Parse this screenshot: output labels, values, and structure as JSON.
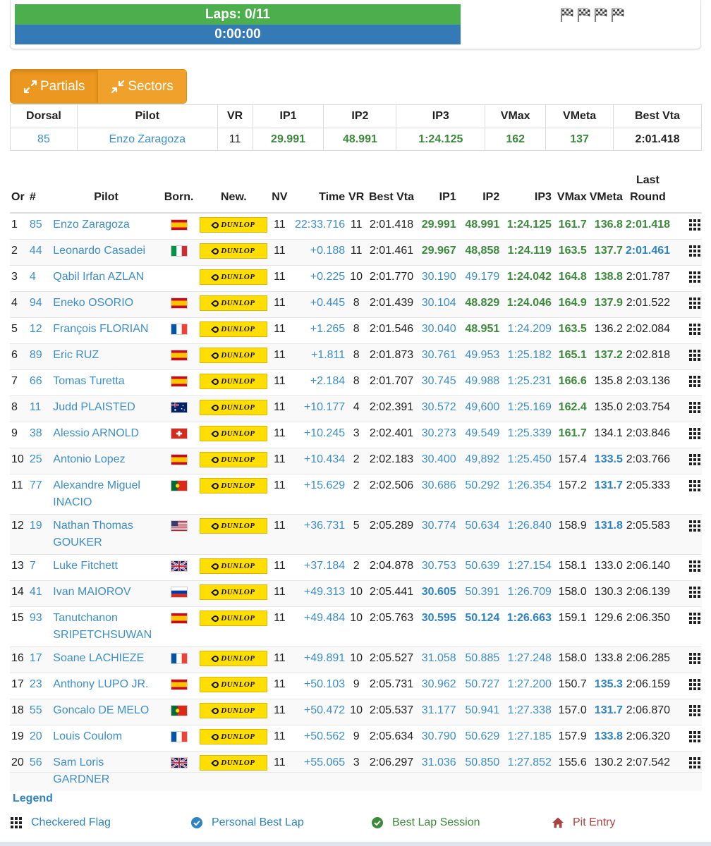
{
  "status": {
    "laps": "Laps: 0/11",
    "time": "0:00:00",
    "flag_icons": [
      "checkered-flag-icon",
      "checkered-flag-icon",
      "checkered-flag-icon",
      "checkered-flag-icon"
    ]
  },
  "tabs": [
    {
      "label": "Partials",
      "icon": "expand-arrows-icon"
    },
    {
      "label": "Sectors",
      "icon": "compress-arrows-icon"
    }
  ],
  "partials": {
    "headers": [
      "Dorsal",
      "Pilot",
      "VR",
      "IP1",
      "IP2",
      "IP3",
      "VMax",
      "VMeta",
      "Best Vta"
    ],
    "row": [
      "85",
      "Enzo Zaragoza",
      "11",
      "29.991",
      "48.991",
      "1:24.125",
      "162",
      "137",
      "2:01.418"
    ]
  },
  "classification": {
    "headers": {
      "or": "Or",
      "num": "#",
      "pilot": "Pilot",
      "born": "Born.",
      "new": "New.",
      "nv": "NV",
      "time": "Time",
      "vr": "VR",
      "best": "Best Vta",
      "ip1": "IP1",
      "ip2": "IP2",
      "ip3": "IP3",
      "vmax": "VMax",
      "vmeta": "VMeta",
      "last1": "Last",
      "last2": "Round"
    },
    "tyre_brand": "DUNLOP",
    "rows": [
      {
        "or": "1",
        "num": "85",
        "pilot": "Enzo Zaragoza",
        "flag": "es",
        "nv": "11",
        "time": "22:33.716",
        "vr": "11",
        "best": "2:01.418",
        "ip1": "29.991",
        "ip2": "48.991",
        "ip3": "1:24.125",
        "vmax": "161.7",
        "vmeta": "136.8",
        "last": "2:01.418",
        "hl": {
          "ip1": "g",
          "ip2": "g",
          "ip3": "g",
          "vmax": "g",
          "vmeta": "g",
          "last": "g"
        }
      },
      {
        "or": "2",
        "num": "44",
        "pilot": "Leonardo Casadei",
        "flag": "it",
        "nv": "11",
        "time": "+0.188",
        "vr": "11",
        "best": "2:01.461",
        "ip1": "29.967",
        "ip2": "48,858",
        "ip3": "1:24.119",
        "vmax": "163.5",
        "vmeta": "137.7",
        "last": "2:01.461",
        "hl": {
          "ip1": "g",
          "ip2": "g",
          "ip3": "g",
          "vmax": "g",
          "vmeta": "g",
          "last": "b"
        }
      },
      {
        "or": "3",
        "num": "4",
        "pilot": "Qabil Irfan AZLAN",
        "flag": "",
        "nv": "11",
        "time": "+0.225",
        "vr": "10",
        "best": "2:01.770",
        "ip1": "30.190",
        "ip2": "49.179",
        "ip3": "1:24.042",
        "vmax": "164.8",
        "vmeta": "138.8",
        "last": "2:01.787",
        "hl": {
          "ip1": "l",
          "ip2": "l",
          "ip3": "g",
          "vmax": "g",
          "vmeta": "g",
          "last": ""
        }
      },
      {
        "or": "4",
        "num": "94",
        "pilot": "Eneko OSORIO",
        "flag": "es",
        "nv": "11",
        "time": "+0.445",
        "vr": "8",
        "best": "2:01.439",
        "ip1": "30.104",
        "ip2": "48.829",
        "ip3": "1:24.046",
        "vmax": "164.9",
        "vmeta": "137.9",
        "last": "2:01.522",
        "hl": {
          "ip1": "l",
          "ip2": "g",
          "ip3": "g",
          "vmax": "g",
          "vmeta": "g",
          "last": ""
        }
      },
      {
        "or": "5",
        "num": "12",
        "pilot": "François FLORIAN",
        "flag": "fr",
        "nv": "11",
        "time": "+1.265",
        "vr": "8",
        "best": "2:01.546",
        "ip1": "30.040",
        "ip2": "48.951",
        "ip3": "1:24.209",
        "vmax": "163.5",
        "vmeta": "136.2",
        "last": "2:02.084",
        "hl": {
          "ip1": "l",
          "ip2": "g",
          "ip3": "l",
          "vmax": "g",
          "vmeta": "",
          "last": ""
        }
      },
      {
        "or": "6",
        "num": "89",
        "pilot": "Eric RUZ",
        "flag": "es",
        "nv": "11",
        "time": "+1.811",
        "vr": "8",
        "best": "2:01.873",
        "ip1": "30.761",
        "ip2": "49.953",
        "ip3": "1:25.182",
        "vmax": "165.1",
        "vmeta": "137.2",
        "last": "2:02.818",
        "hl": {
          "ip1": "l",
          "ip2": "l",
          "ip3": "l",
          "vmax": "g",
          "vmeta": "g",
          "last": ""
        }
      },
      {
        "or": "7",
        "num": "66",
        "pilot": "Tomas Turetta",
        "flag": "es",
        "nv": "11",
        "time": "+2.184",
        "vr": "8",
        "best": "2:01.707",
        "ip1": "30.745",
        "ip2": "49.988",
        "ip3": "1:25.231",
        "vmax": "166.6",
        "vmeta": "135.8",
        "last": "2:03.136",
        "hl": {
          "ip1": "l",
          "ip2": "l",
          "ip3": "l",
          "vmax": "g",
          "vmeta": "",
          "last": ""
        }
      },
      {
        "or": "8",
        "num": "11",
        "pilot": "Judd PLAISTED",
        "flag": "au",
        "nv": "11",
        "time": "+10.177",
        "vr": "4",
        "best": "2:02.391",
        "ip1": "30.572",
        "ip2": "49,600",
        "ip3": "1:25.169",
        "vmax": "162.4",
        "vmeta": "135.0",
        "last": "2:03.754",
        "hl": {
          "ip1": "l",
          "ip2": "l",
          "ip3": "l",
          "vmax": "g",
          "vmeta": "",
          "last": ""
        }
      },
      {
        "or": "9",
        "num": "38",
        "pilot": "Alessio ARNOLD",
        "flag": "ch",
        "nv": "11",
        "time": "+10.245",
        "vr": "3",
        "best": "2:02.401",
        "ip1": "30.273",
        "ip2": "49.549",
        "ip3": "1:25.339",
        "vmax": "161.7",
        "vmeta": "134.1",
        "last": "2:03.846",
        "hl": {
          "ip1": "l",
          "ip2": "l",
          "ip3": "l",
          "vmax": "g",
          "vmeta": "",
          "last": ""
        }
      },
      {
        "or": "10",
        "num": "25",
        "pilot": "Antonio Lopez",
        "flag": "es",
        "nv": "11",
        "time": "+10.434",
        "vr": "2",
        "best": "2:02.183",
        "ip1": "30.400",
        "ip2": "49,892",
        "ip3": "1:25.450",
        "vmax": "157.4",
        "vmeta": "133.5",
        "last": "2:03.766",
        "hl": {
          "ip1": "l",
          "ip2": "l",
          "ip3": "l",
          "vmax": "",
          "vmeta": "b",
          "last": ""
        }
      },
      {
        "or": "11",
        "num": "77",
        "pilot": "Alexandre Miguel INACIO",
        "flag": "pt",
        "nv": "11",
        "time": "+15.629",
        "vr": "2",
        "best": "2:02.506",
        "ip1": "30.686",
        "ip2": "50.292",
        "ip3": "1:26.354",
        "vmax": "157.2",
        "vmeta": "131.7",
        "last": "2:05.333",
        "hl": {
          "ip1": "l",
          "ip2": "l",
          "ip3": "l",
          "vmax": "",
          "vmeta": "b",
          "last": ""
        }
      },
      {
        "or": "12",
        "num": "19",
        "pilot": "Nathan Thomas GOUKER",
        "flag": "us",
        "nv": "11",
        "time": "+36.731",
        "vr": "5",
        "best": "2:05.289",
        "ip1": "30.774",
        "ip2": "50.634",
        "ip3": "1:26.840",
        "vmax": "158.9",
        "vmeta": "131.8",
        "last": "2:05.583",
        "hl": {
          "ip1": "l",
          "ip2": "l",
          "ip3": "l",
          "vmax": "",
          "vmeta": "b",
          "last": ""
        }
      },
      {
        "or": "13",
        "num": "7",
        "pilot": "Luke Fitchett",
        "flag": "gb",
        "nv": "11",
        "time": "+37.184",
        "vr": "2",
        "best": "2:04.878",
        "ip1": "30.753",
        "ip2": "50.639",
        "ip3": "1:27.154",
        "vmax": "158.1",
        "vmeta": "133.0",
        "last": "2:06.140",
        "hl": {
          "ip1": "l",
          "ip2": "l",
          "ip3": "l",
          "vmax": "",
          "vmeta": "",
          "last": ""
        }
      },
      {
        "or": "14",
        "num": "41",
        "pilot": "Ivan MAIOROV",
        "flag": "ru",
        "nv": "11",
        "time": "+49.313",
        "vr": "10",
        "best": "2:05.441",
        "ip1": "30.605",
        "ip2": "50.391",
        "ip3": "1:26.709",
        "vmax": "158.0",
        "vmeta": "130.3",
        "last": "2:06.139",
        "hl": {
          "ip1": "b",
          "ip2": "l",
          "ip3": "l",
          "vmax": "",
          "vmeta": "",
          "last": ""
        }
      },
      {
        "or": "15",
        "num": "93",
        "pilot": "Tanutchanon SRIPETCHSUWAN",
        "flag": "es",
        "nv": "11",
        "time": "+49.484",
        "vr": "10",
        "best": "2:05.763",
        "ip1": "30.595",
        "ip2": "50.124",
        "ip3": "1:26.663",
        "vmax": "159.1",
        "vmeta": "129.6",
        "last": "2:06.350",
        "hl": {
          "ip1": "b",
          "ip2": "b",
          "ip3": "b",
          "vmax": "",
          "vmeta": "",
          "last": ""
        }
      },
      {
        "or": "16",
        "num": "17",
        "pilot": "Soane LACHIEZE",
        "flag": "fr",
        "nv": "11",
        "time": "+49.891",
        "vr": "10",
        "best": "2:05.527",
        "ip1": "31.058",
        "ip2": "50.885",
        "ip3": "1:27.248",
        "vmax": "158.0",
        "vmeta": "133.8",
        "last": "2:06.285",
        "hl": {
          "ip1": "l",
          "ip2": "l",
          "ip3": "l",
          "vmax": "",
          "vmeta": "",
          "last": ""
        }
      },
      {
        "or": "17",
        "num": "23",
        "pilot": "Anthony LUPO JR.",
        "flag": "es",
        "nv": "11",
        "time": "+50.103",
        "vr": "9",
        "best": "2:05.731",
        "ip1": "30.962",
        "ip2": "50.727",
        "ip3": "1:27.200",
        "vmax": "150.7",
        "vmeta": "135.3",
        "last": "2:06.159",
        "hl": {
          "ip1": "l",
          "ip2": "l",
          "ip3": "l",
          "vmax": "",
          "vmeta": "b",
          "last": ""
        }
      },
      {
        "or": "18",
        "num": "55",
        "pilot": "Goncalo DE MELO",
        "flag": "pt",
        "nv": "11",
        "time": "+50.472",
        "vr": "10",
        "best": "2:05.537",
        "ip1": "31.177",
        "ip2": "50.941",
        "ip3": "1:27.338",
        "vmax": "157.0",
        "vmeta": "131.7",
        "last": "2:06.870",
        "hl": {
          "ip1": "l",
          "ip2": "l",
          "ip3": "l",
          "vmax": "",
          "vmeta": "b",
          "last": ""
        }
      },
      {
        "or": "19",
        "num": "20",
        "pilot": "Louis Coulom",
        "flag": "fr",
        "nv": "11",
        "time": "+50.562",
        "vr": "9",
        "best": "2:05.634",
        "ip1": "30.790",
        "ip2": "50.629",
        "ip3": "1:27.185",
        "vmax": "157.9",
        "vmeta": "133.8",
        "last": "2:06.320",
        "hl": {
          "ip1": "l",
          "ip2": "l",
          "ip3": "l",
          "vmax": "",
          "vmeta": "b",
          "last": ""
        }
      },
      {
        "or": "20",
        "num": "56",
        "pilot": "Sam Loris GARDNER",
        "flag": "gb",
        "nv": "11",
        "time": "+55.065",
        "vr": "3",
        "best": "2:06.297",
        "ip1": "31.036",
        "ip2": "50.850",
        "ip3": "1:27.852",
        "vmax": "155.6",
        "vmeta": "130.2",
        "last": "2:07.542",
        "hl": {
          "ip1": "l",
          "ip2": "l",
          "ip3": "l",
          "vmax": "",
          "vmeta": "",
          "last": ""
        }
      }
    ]
  },
  "legend": {
    "title": "Legend",
    "items": [
      {
        "icon": "checkered-grid-icon",
        "label": "Checkered Flag",
        "color": "#2e83c4"
      },
      {
        "icon": "check-circle-blue-icon",
        "label": "Personal Best Lap",
        "color": "#2e83c4"
      },
      {
        "icon": "check-circle-green-icon",
        "label": "Best Lap Session",
        "color": "#3c8a3c"
      },
      {
        "icon": "home-icon",
        "label": "Pit Entry",
        "color": "#a94442"
      }
    ]
  },
  "colors": {
    "green": "#3c8a3c",
    "blue": "#2e83c4",
    "link": "#3d8ec9",
    "orange": "#f0a12b",
    "bar_green": "#4cae4c",
    "bar_blue": "#337ab7",
    "dunlop": "#ffde00"
  }
}
